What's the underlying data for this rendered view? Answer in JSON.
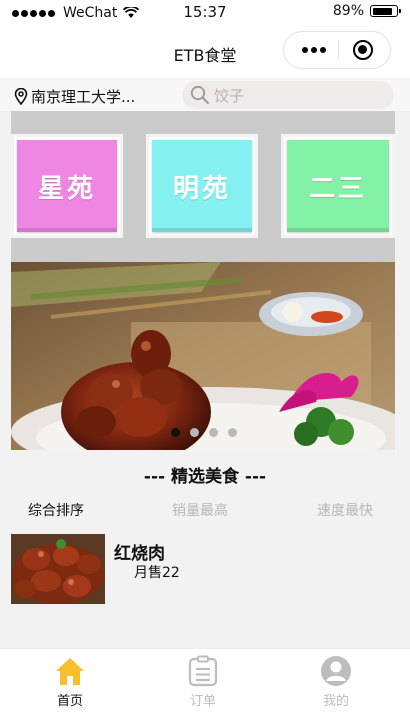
{
  "status_bar": {
    "carrier": "WeChat",
    "time": "15:37",
    "battery_text": "89%",
    "battery_level": 0.89
  },
  "nav": {
    "title": "ETB食堂"
  },
  "location": {
    "campus": "南京理工大学..."
  },
  "search": {
    "placeholder": "饺子"
  },
  "categories": [
    {
      "label": "星苑",
      "color": "#ef86e2"
    },
    {
      "label": "明苑",
      "color": "#84f0ef"
    },
    {
      "label": "二三",
      "color": "#84f2a6"
    }
  ],
  "banner": {
    "slide_count": 4,
    "active_index": 0
  },
  "featured": {
    "title": "--- 精选美食 ---",
    "sorts": [
      "综合排序",
      "销量最高",
      "速度最快"
    ],
    "active_sort": 0,
    "items": [
      {
        "name": "红烧肉",
        "sales": "月售22"
      }
    ]
  },
  "tabbar": {
    "tabs": [
      {
        "label": "首页",
        "icon": "home-icon",
        "active": true
      },
      {
        "label": "订单",
        "icon": "order-list-icon",
        "active": false
      },
      {
        "label": "我的",
        "icon": "profile-icon",
        "active": false
      }
    ],
    "active_color": "#f5c02a",
    "inactive_color": "#bdbdbd"
  }
}
